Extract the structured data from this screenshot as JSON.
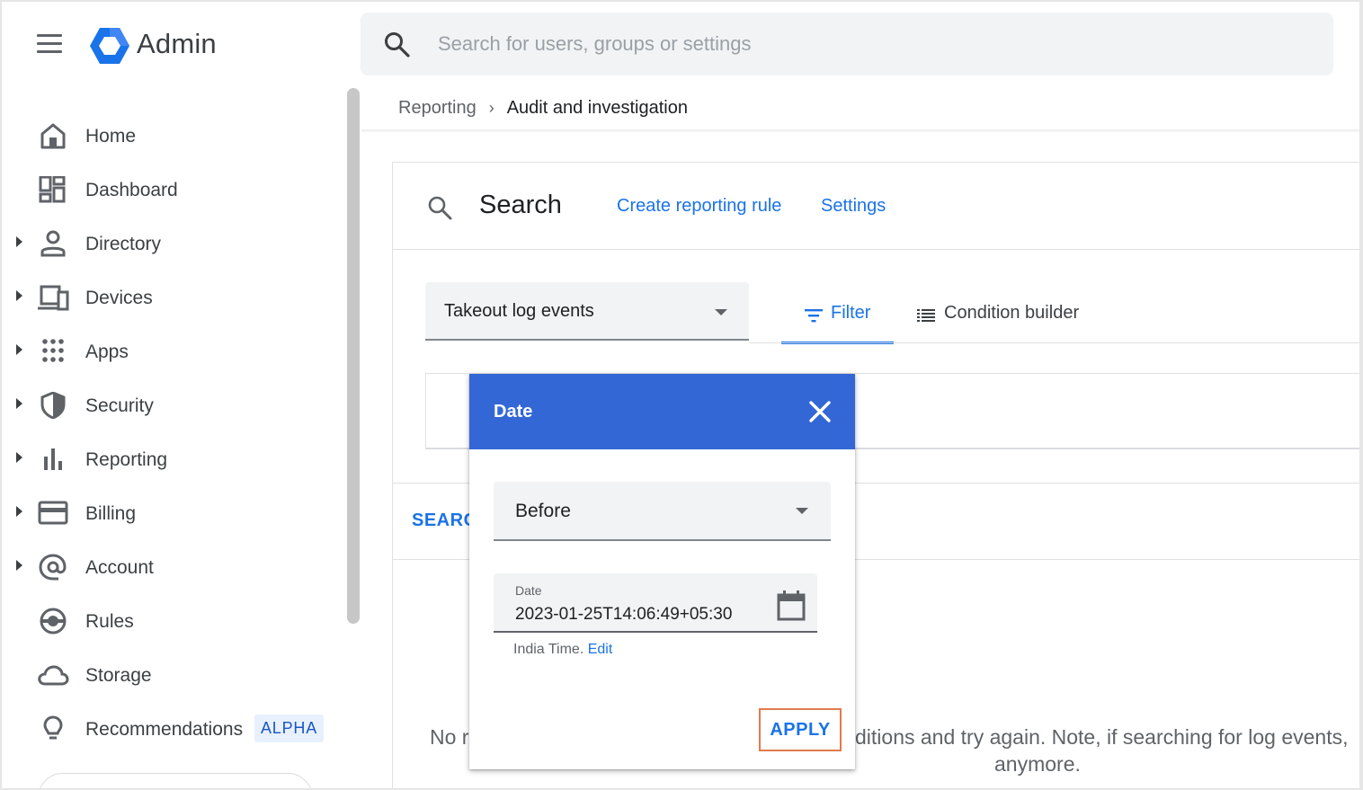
{
  "app": {
    "title": "Admin",
    "menu_icon": "hamburger-menu-icon",
    "logo_icon": "admin-hexagon-logo",
    "brand_color": "#1a73e8"
  },
  "search": {
    "placeholder": "Search for users, groups or settings",
    "icon": "search-icon"
  },
  "breadcrumb": {
    "parent": "Reporting",
    "separator": "›",
    "current": "Audit and investigation"
  },
  "sidebar": {
    "items": [
      {
        "label": "Home",
        "icon": "home-icon",
        "expandable": false
      },
      {
        "label": "Dashboard",
        "icon": "dashboard-icon",
        "expandable": false
      },
      {
        "label": "Directory",
        "icon": "person-icon",
        "expandable": true
      },
      {
        "label": "Devices",
        "icon": "devices-icon",
        "expandable": true
      },
      {
        "label": "Apps",
        "icon": "apps-grid-icon",
        "expandable": true
      },
      {
        "label": "Security",
        "icon": "shield-icon",
        "expandable": true
      },
      {
        "label": "Reporting",
        "icon": "bar-chart-icon",
        "expandable": true
      },
      {
        "label": "Billing",
        "icon": "credit-card-icon",
        "expandable": true
      },
      {
        "label": "Account",
        "icon": "at-sign-icon",
        "expandable": true
      },
      {
        "label": "Rules",
        "icon": "rules-icon",
        "expandable": false
      },
      {
        "label": "Storage",
        "icon": "cloud-icon",
        "expandable": false
      },
      {
        "label": "Recommendations",
        "icon": "lightbulb-icon",
        "expandable": false,
        "badge": "ALPHA"
      }
    ]
  },
  "main": {
    "header": {
      "title": "Search",
      "icon": "search-icon",
      "links": [
        "Create reporting rule",
        "Settings"
      ]
    },
    "source_select": {
      "value": "Takeout log events"
    },
    "tabs": [
      {
        "label": "Filter",
        "icon": "filter-icon",
        "active": true
      },
      {
        "label": "Condition builder",
        "icon": "list-icon",
        "active": false
      }
    ],
    "search_action": "SEARCH",
    "empty_message": {
      "left_fragment": "No r",
      "right_fragment": "ditions and try again. Note, if searching for log events,",
      "second_line": "anymore."
    }
  },
  "dialog": {
    "title": "Date",
    "header_color": "#3367d6",
    "close_icon": "close-icon",
    "operator": "Before",
    "date_field": {
      "label": "Date",
      "value": "2023-01-25T14:06:49+05:30",
      "icon": "calendar-icon"
    },
    "timezone_text": "India Time.",
    "timezone_edit": "Edit",
    "apply_label": "APPLY",
    "apply_highlight_color": "#e07a4f"
  }
}
